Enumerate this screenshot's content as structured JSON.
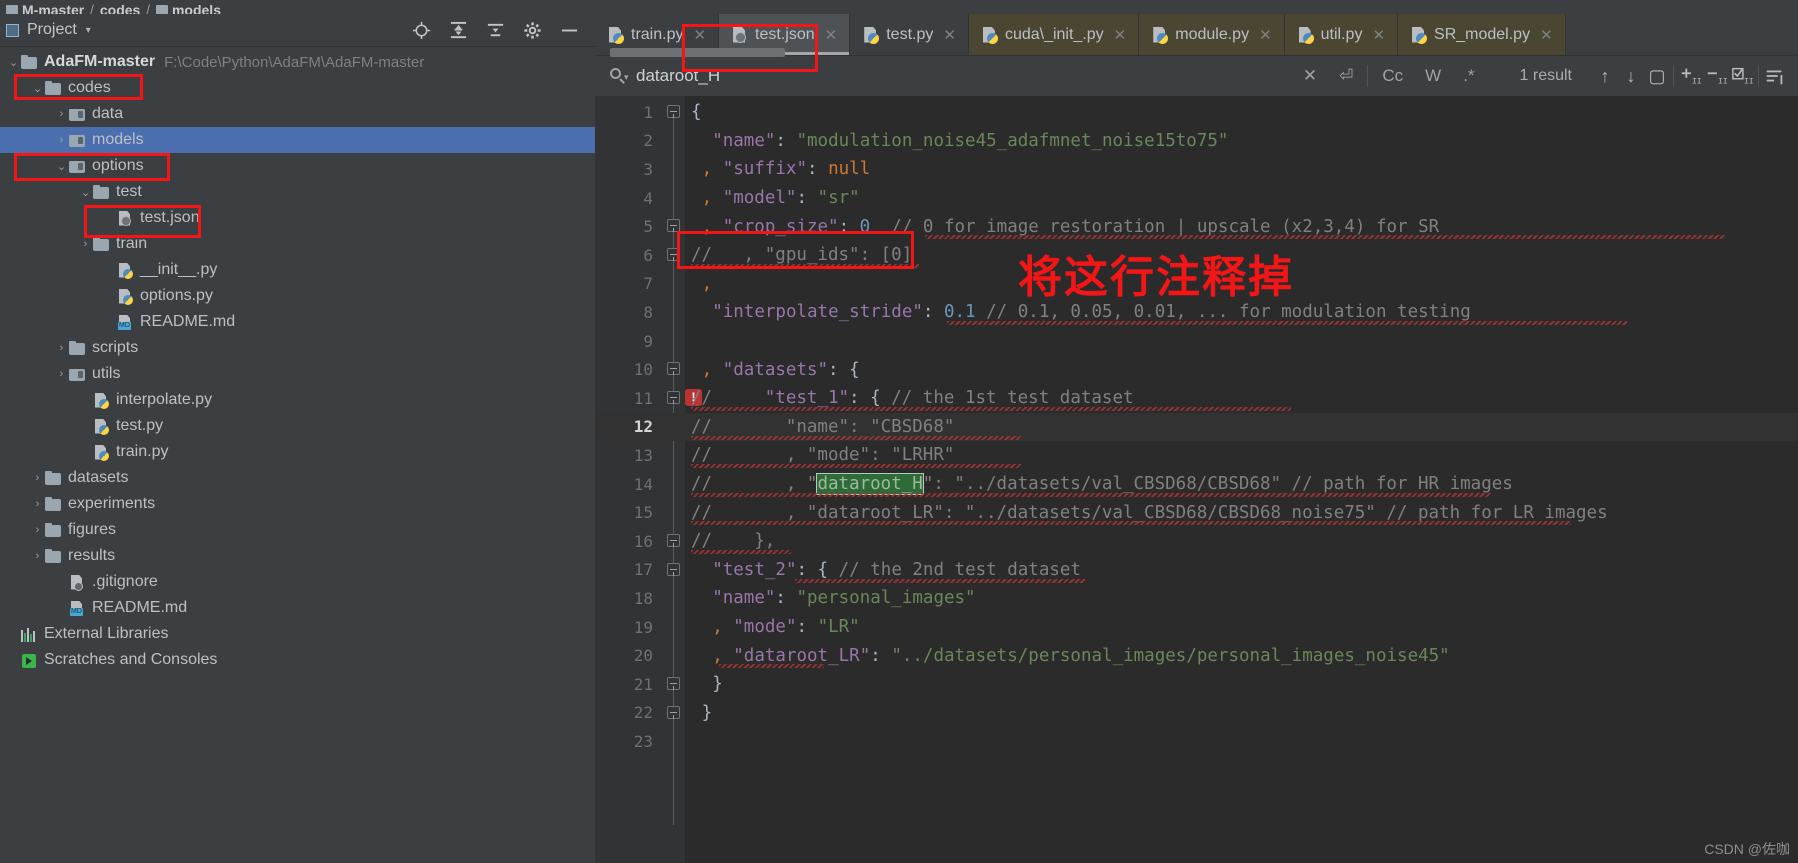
{
  "breadcrumb": {
    "items": [
      "M-master",
      "codes",
      "models"
    ],
    "separator": "/"
  },
  "project_panel": {
    "title": "Project",
    "dropdown_caret": "▾",
    "tools": [
      "locate-icon",
      "collapse-all-icon",
      "expand-icon",
      "settings-gear-icon",
      "minimize-icon"
    ],
    "tree": [
      {
        "label": "AdaFM-master",
        "path": "F:\\Code\\Python\\AdaFM\\AdaFM-master",
        "indent": 0,
        "arrow": "v",
        "icon": "folder",
        "bold": true
      },
      {
        "label": "codes",
        "path": "",
        "indent": 1,
        "arrow": "v",
        "icon": "folder",
        "bold": false
      },
      {
        "label": "data",
        "path": "",
        "indent": 2,
        "arrow": ">",
        "icon": "folder-module",
        "bold": false
      },
      {
        "label": "models",
        "path": "",
        "indent": 2,
        "arrow": ">",
        "icon": "folder-module",
        "bold": false,
        "selected": true
      },
      {
        "label": "options",
        "path": "",
        "indent": 2,
        "arrow": "v",
        "icon": "folder-module",
        "bold": false
      },
      {
        "label": "test",
        "path": "",
        "indent": 3,
        "arrow": "v",
        "icon": "folder",
        "bold": false
      },
      {
        "label": "test.json",
        "path": "",
        "indent": 4,
        "arrow": "",
        "icon": "json",
        "bold": false
      },
      {
        "label": "train",
        "path": "",
        "indent": 3,
        "arrow": ">",
        "icon": "folder",
        "bold": false
      },
      {
        "label": "__init__.py",
        "path": "",
        "indent": 4,
        "arrow": "",
        "icon": "py",
        "bold": false
      },
      {
        "label": "options.py",
        "path": "",
        "indent": 4,
        "arrow": "",
        "icon": "py",
        "bold": false
      },
      {
        "label": "README.md",
        "path": "",
        "indent": 4,
        "arrow": "",
        "icon": "md",
        "bold": false
      },
      {
        "label": "scripts",
        "path": "",
        "indent": 2,
        "arrow": ">",
        "icon": "folder",
        "bold": false
      },
      {
        "label": "utils",
        "path": "",
        "indent": 2,
        "arrow": ">",
        "icon": "folder-module",
        "bold": false
      },
      {
        "label": "interpolate.py",
        "path": "",
        "indent": 3,
        "arrow": "",
        "icon": "py",
        "bold": false
      },
      {
        "label": "test.py",
        "path": "",
        "indent": 3,
        "arrow": "",
        "icon": "py",
        "bold": false
      },
      {
        "label": "train.py",
        "path": "",
        "indent": 3,
        "arrow": "",
        "icon": "py",
        "bold": false
      },
      {
        "label": "datasets",
        "path": "",
        "indent": 1,
        "arrow": ">",
        "icon": "folder",
        "bold": false
      },
      {
        "label": "experiments",
        "path": "",
        "indent": 1,
        "arrow": ">",
        "icon": "folder",
        "bold": false
      },
      {
        "label": "figures",
        "path": "",
        "indent": 1,
        "arrow": ">",
        "icon": "folder",
        "bold": false
      },
      {
        "label": "results",
        "path": "",
        "indent": 1,
        "arrow": ">",
        "icon": "folder",
        "bold": false
      },
      {
        "label": ".gitignore",
        "path": "",
        "indent": 2,
        "arrow": "",
        "icon": "git",
        "bold": false
      },
      {
        "label": "README.md",
        "path": "",
        "indent": 2,
        "arrow": "",
        "icon": "md",
        "bold": false
      },
      {
        "label": "External Libraries",
        "path": "",
        "indent": 0,
        "arrow": "",
        "icon": "lib",
        "bold": false
      },
      {
        "label": "Scratches and Consoles",
        "path": "",
        "indent": 0,
        "arrow": "",
        "icon": "scratches",
        "bold": false
      }
    ]
  },
  "editor": {
    "tabs": [
      {
        "label": "train.py",
        "icon": "py-icon",
        "state": "normal"
      },
      {
        "label": "test.json",
        "icon": "json-icon",
        "state": "active"
      },
      {
        "label": "test.py",
        "icon": "py-icon",
        "state": "normal"
      },
      {
        "label": "cuda\\_init_.py",
        "icon": "py-icon",
        "state": "modified"
      },
      {
        "label": "module.py",
        "icon": "py-icon",
        "state": "modified"
      },
      {
        "label": "util.py",
        "icon": "py-icon",
        "state": "modified"
      },
      {
        "label": "SR_model.py",
        "icon": "py-icon",
        "state": "modified"
      }
    ],
    "find": {
      "query": "dataroot_H",
      "result_count_label": "1 result",
      "close_label": "✕",
      "newline_label": "⏎",
      "match_case_label": "Cc",
      "words_label": "W",
      "regex_label": ".*",
      "prev_label": "↑",
      "next_label": "↓",
      "select_all_label": "▢",
      "add_label": "+",
      "remove_label": "−",
      "select_occurrences_label": "☑",
      "filter_label": "≣"
    },
    "code_lines": [
      {
        "num": "1",
        "fold": "open",
        "tokens": [
          {
            "t": "{",
            "c": "w"
          }
        ]
      },
      {
        "num": "2",
        "fold": "",
        "indent": 2,
        "tokens": [
          {
            "t": "\"name\"",
            "c": "k"
          },
          {
            "t": ": ",
            "c": "w"
          },
          {
            "t": "\"modulation_noise45_adafmnet_noise15to75\"",
            "c": "s"
          }
        ]
      },
      {
        "num": "3",
        "fold": "",
        "indent": 1,
        "tokens": [
          {
            "t": ",",
            "c": "o"
          },
          {
            "t": " ",
            "c": "w"
          },
          {
            "t": "\"suffix\"",
            "c": "k"
          },
          {
            "t": ": ",
            "c": "w"
          },
          {
            "t": "null",
            "c": "o"
          }
        ]
      },
      {
        "num": "4",
        "fold": "",
        "indent": 1,
        "tokens": [
          {
            "t": ",",
            "c": "o"
          },
          {
            "t": " ",
            "c": "w"
          },
          {
            "t": "\"model\"",
            "c": "k"
          },
          {
            "t": ": ",
            "c": "w"
          },
          {
            "t": "\"sr\"",
            "c": "s"
          }
        ]
      },
      {
        "num": "5",
        "fold": "open",
        "indent": 1,
        "tokens": [
          {
            "t": ",",
            "c": "o"
          },
          {
            "t": " ",
            "c": "w"
          },
          {
            "t": "\"crop_size\"",
            "c": "k"
          },
          {
            "t": ": ",
            "c": "w"
          },
          {
            "t": "0",
            "c": "n"
          },
          {
            "t": "  ",
            "c": "w"
          },
          {
            "t": "// 0 for image restoration | upscale (x2,3,4) for SR",
            "c": "c"
          }
        ]
      },
      {
        "num": "6",
        "fold": "open",
        "indent": 0,
        "tokens": [
          {
            "t": "//   , \"gpu_ids\": [0]",
            "c": "cm"
          }
        ]
      },
      {
        "num": "7",
        "fold": "",
        "indent": 1,
        "tokens": [
          {
            "t": ",",
            "c": "o"
          }
        ]
      },
      {
        "num": "8",
        "fold": "",
        "indent": 2,
        "tokens": [
          {
            "t": "\"interpolate_stride\"",
            "c": "k"
          },
          {
            "t": ": ",
            "c": "w"
          },
          {
            "t": "0.1",
            "c": "n"
          },
          {
            "t": " ",
            "c": "w"
          },
          {
            "t": "// 0.1, 0.05, 0.01, ... for modulation testing",
            "c": "c"
          }
        ]
      },
      {
        "num": "9",
        "fold": "",
        "indent": 0,
        "tokens": []
      },
      {
        "num": "10",
        "fold": "open",
        "indent": 1,
        "tokens": [
          {
            "t": ",",
            "c": "o"
          },
          {
            "t": " ",
            "c": "w"
          },
          {
            "t": "\"datasets\"",
            "c": "k"
          },
          {
            "t": ": {",
            "c": "w"
          }
        ]
      },
      {
        "num": "11",
        "fold": "open",
        "indent": 0,
        "warn": true,
        "tokens": [
          {
            "t": "//",
            "c": "cm"
          },
          {
            "t": "     \"test_1\"",
            "c": "k"
          },
          {
            "t": ": { ",
            "c": "w"
          },
          {
            "t": "// the 1st test dataset",
            "c": "c"
          }
        ]
      },
      {
        "num": "12",
        "fold": "",
        "current": true,
        "indent": 0,
        "tokens": [
          {
            "t": "//       \"name\": \"CBSD68\"",
            "c": "cm"
          }
        ]
      },
      {
        "num": "13",
        "fold": "",
        "indent": 0,
        "tokens": [
          {
            "t": "//       , \"mode\": \"LRHR\"",
            "c": "cm"
          }
        ]
      },
      {
        "num": "14",
        "fold": "",
        "indent": 0,
        "tokens": [
          {
            "t": "//       , \"",
            "c": "cm"
          },
          {
            "t": "dataroot_H",
            "c": "hit"
          },
          {
            "t": "\": \"../datasets/val_CBSD68/CBSD68\" // path for HR images",
            "c": "cm"
          }
        ]
      },
      {
        "num": "15",
        "fold": "",
        "indent": 0,
        "tokens": [
          {
            "t": "//       , \"dataroot_LR\": \"../datasets/val_CBSD68/CBSD68_noise75\" // path for LR images",
            "c": "cm"
          }
        ]
      },
      {
        "num": "16",
        "fold": "open",
        "indent": 0,
        "tokens": [
          {
            "t": "//    },",
            "c": "cm"
          }
        ]
      },
      {
        "num": "17",
        "fold": "open",
        "indent": 2,
        "tokens": [
          {
            "t": "\"test_2\"",
            "c": "k"
          },
          {
            "t": ": { ",
            "c": "w"
          },
          {
            "t": "// the 2nd test dataset",
            "c": "c"
          }
        ]
      },
      {
        "num": "18",
        "fold": "",
        "indent": 2,
        "tokens": [
          {
            "t": "\"name\"",
            "c": "k"
          },
          {
            "t": ": ",
            "c": "w"
          },
          {
            "t": "\"personal_images\"",
            "c": "s"
          }
        ]
      },
      {
        "num": "19",
        "fold": "",
        "indent": 2,
        "tokens": [
          {
            "t": ", ",
            "c": "o"
          },
          {
            "t": "\"mode\"",
            "c": "k"
          },
          {
            "t": ": ",
            "c": "w"
          },
          {
            "t": "\"LR\"",
            "c": "s"
          }
        ]
      },
      {
        "num": "20",
        "fold": "",
        "indent": 2,
        "tokens": [
          {
            "t": ", ",
            "c": "o"
          },
          {
            "t": "\"dataroot_LR\"",
            "c": "k"
          },
          {
            "t": ": ",
            "c": "w"
          },
          {
            "t": "\"../datasets/personal_images/personal_images_noise45\"",
            "c": "s"
          }
        ]
      },
      {
        "num": "21",
        "fold": "open",
        "indent": 2,
        "tokens": [
          {
            "t": "}",
            "c": "w"
          }
        ]
      },
      {
        "num": "22",
        "fold": "open",
        "indent": 1,
        "tokens": [
          {
            "t": "}",
            "c": "w"
          }
        ]
      },
      {
        "num": "23",
        "fold": "",
        "indent": 0,
        "tokens": []
      }
    ],
    "annotation": "将这行注释掉",
    "watermark": "CSDN @佐咖"
  },
  "colors": {
    "annotation_red": "#f41616",
    "selection_blue": "#4b6eaf",
    "search_hit_green": "#2f6b3a",
    "editor_bg": "#2b2b2b",
    "panel_bg": "#3c3f41"
  }
}
